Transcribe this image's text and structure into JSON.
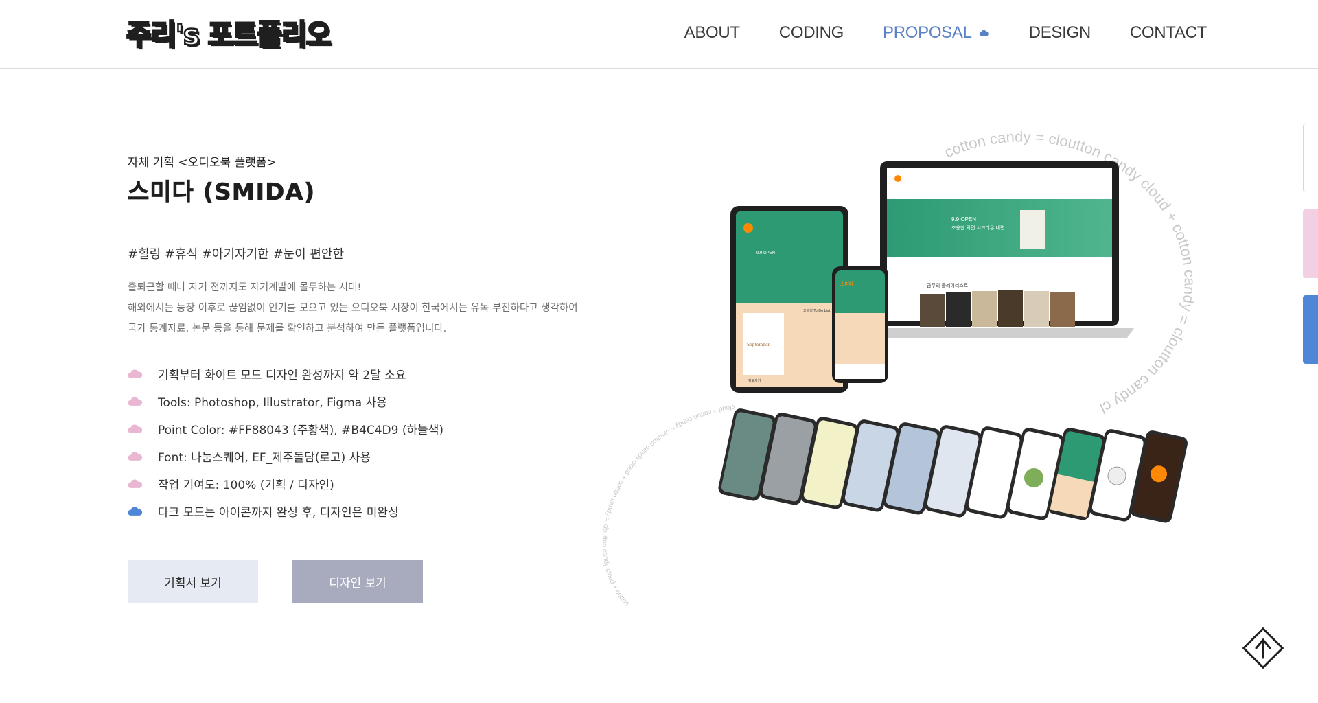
{
  "header": {
    "logo_main": "주리",
    "logo_tail": "'s 포트폴리오",
    "nav": [
      {
        "label": "ABOUT",
        "active": false
      },
      {
        "label": "CODING",
        "active": false
      },
      {
        "label": "PROPOSAL",
        "active": true
      },
      {
        "label": "DESIGN",
        "active": false
      },
      {
        "label": "CONTACT",
        "active": false
      }
    ]
  },
  "project": {
    "subtitle": "자체 기획 <오디오북 플랫폼>",
    "title": "스미다 (SMIDA)",
    "tags": "#힐링 #휴식 #아기자기한 #눈이 편안한",
    "description": [
      "출퇴근할 때나 자기 전까지도 자기계발에 몰두하는 시대!",
      "해외에서는 등장 이후로 끊임없이 인기를 모으고 있는 오디오북 시장이 한국에서는 유독 부진하다고 생각하여",
      "국가 통계자료, 논문 등을 통해 문제를 확인하고 분석하여 만든 플랫폼입니다."
    ],
    "features": [
      {
        "text": "기획부터 화이트 모드 디자인 완성까지 약 2달 소요",
        "icon": "pink-cloud-icon"
      },
      {
        "text": "Tools: Photoshop, Illustrator, Figma 사용",
        "icon": "pink-cloud-icon"
      },
      {
        "text": "Point Color: #FF88043 (주황색), #B4C4D9 (하늘색)",
        "icon": "pink-cloud-icon"
      },
      {
        "text": "Font: 나눔스퀘어, EF_제주돌담(로고) 사용",
        "icon": "pink-cloud-icon"
      },
      {
        "text": "작업 기여도: 100% (기획 / 디자인)",
        "icon": "pink-cloud-icon"
      },
      {
        "text": "다크 모드는 아이콘까지 완성 후, 디자인은 미완성",
        "icon": "blue-cloud-icon"
      }
    ],
    "buttons": {
      "plan": "기획서 보기",
      "design": "디자인 보기"
    }
  },
  "mockup": {
    "ring_text_top": "cotton candy = cloutton candy  cloud + cotton candy = cloutton candy  cloud + cotton",
    "ring_text_bottom": "cloud + cotton candy = cloutton candy  cloud + cotton candy = cloutton candy  cloud + cotton",
    "banner_line1": "9.9 OPEN",
    "banner_line2": "조용한 외면 시크리온 내면",
    "playlist_label": "금주의 플레이리스트",
    "tablet_todo": "오늘의 To Do List",
    "tablet_month": "September",
    "tablet_back": "뒤로가기",
    "phone_logo": "스미다"
  },
  "colors": {
    "accent_blue": "#5b82c7",
    "pink_cloud": "#e9b7d1",
    "blue_cloud": "#4f86d6",
    "brand_green": "#2e9a73",
    "brand_orange": "#ff8804"
  }
}
